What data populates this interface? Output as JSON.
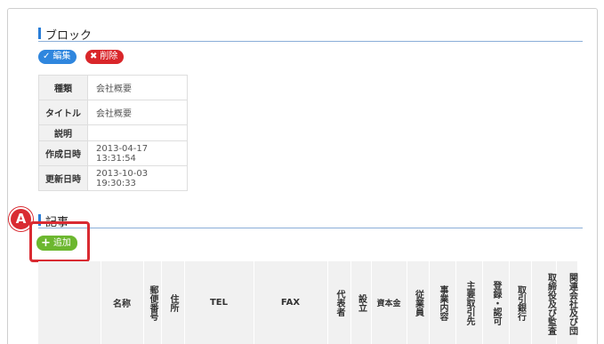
{
  "block_section": {
    "title": "ブロック"
  },
  "actions": {
    "edit_label": "編集",
    "delete_label": "削除"
  },
  "info": {
    "rows": [
      {
        "label": "種類",
        "value": "会社概要"
      },
      {
        "label": "タイトル",
        "value": "会社概要"
      },
      {
        "label": "説明",
        "value": ""
      },
      {
        "label": "作成日時",
        "value": "2013-04-17 13:31:54"
      },
      {
        "label": "更新日時",
        "value": "2013-10-03 19:30:33"
      }
    ]
  },
  "articles_section": {
    "title": "記事",
    "marker_label": "A",
    "add_label": "追加"
  },
  "grid": {
    "headers": [
      "",
      "名称",
      "郵便番号",
      "住所",
      "TEL",
      "FAX",
      "代表者",
      "設立",
      "資本金",
      "従業員",
      "事業内容",
      "主要取引先",
      "登録・認可",
      "取引銀行",
      "取締役及び監査",
      "関連会社及び団"
    ]
  },
  "colors": {
    "accent_blue": "#2f86de",
    "delete_red": "#d9262a",
    "add_green": "#6cb72f",
    "highlight_red": "#d92b32"
  }
}
